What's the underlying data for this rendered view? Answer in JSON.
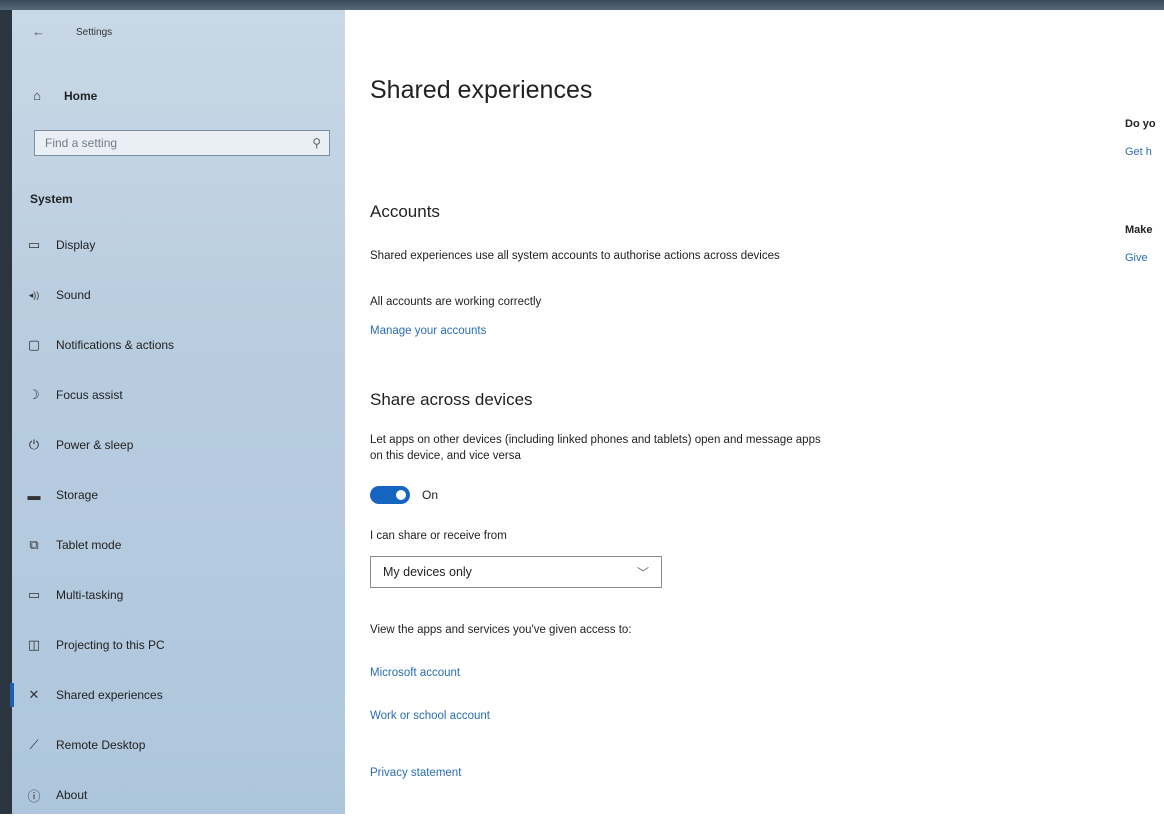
{
  "window": {
    "back_glyph": "←",
    "title": "Settings"
  },
  "sidebar": {
    "home_label": "Home",
    "search_placeholder": "Find a setting",
    "section_header": "System",
    "items": [
      {
        "label": "Display",
        "icon": "monitor-icon",
        "glyph": "▭"
      },
      {
        "label": "Sound",
        "icon": "speaker-icon",
        "glyph": "◂))"
      },
      {
        "label": "Notifications & actions",
        "icon": "notification-icon",
        "glyph": "▢"
      },
      {
        "label": "Focus assist",
        "icon": "moon-icon",
        "glyph": "☽"
      },
      {
        "label": "Power & sleep",
        "icon": "power-icon",
        "glyph": "⏻"
      },
      {
        "label": "Storage",
        "icon": "storage-icon",
        "glyph": "▬"
      },
      {
        "label": "Tablet mode",
        "icon": "tablet-mode-icon",
        "glyph": "⧉"
      },
      {
        "label": "Multi-tasking",
        "icon": "multitasking-icon",
        "glyph": "▭"
      },
      {
        "label": "Projecting to this PC",
        "icon": "projecting-icon",
        "glyph": "◫"
      },
      {
        "label": "Shared experiences",
        "icon": "shared-experiences-icon",
        "glyph": "✕",
        "active": true
      },
      {
        "label": "Remote Desktop",
        "icon": "remote-desktop-icon",
        "glyph": "⟋"
      },
      {
        "label": "About",
        "icon": "info-icon",
        "glyph": "ⓘ"
      }
    ]
  },
  "main": {
    "title": "Shared experiences",
    "accounts": {
      "heading": "Accounts",
      "description": "Shared experiences use all system accounts to authorise actions across devices",
      "status": "All accounts are working correctly",
      "manage_link": "Manage your accounts"
    },
    "share": {
      "heading": "Share across devices",
      "description": "Let apps on other devices (including linked phones and tablets) open and message apps on this device, and vice versa",
      "toggle_state": "On",
      "toggle_on": true,
      "receive_label": "I can share or receive from",
      "receive_value": "My devices only",
      "view_label": "View the apps and services you've given access to:",
      "microsoft_link": "Microsoft account",
      "work_link": "Work or school account",
      "privacy_link": "Privacy statement"
    }
  },
  "right": {
    "q1": "Do yo",
    "l1": "Get h",
    "q2": "Make",
    "l2": "Give "
  },
  "colors": {
    "accent": "#1565c0",
    "link": "#2a6db5",
    "sidebar": "#b9cde0"
  }
}
